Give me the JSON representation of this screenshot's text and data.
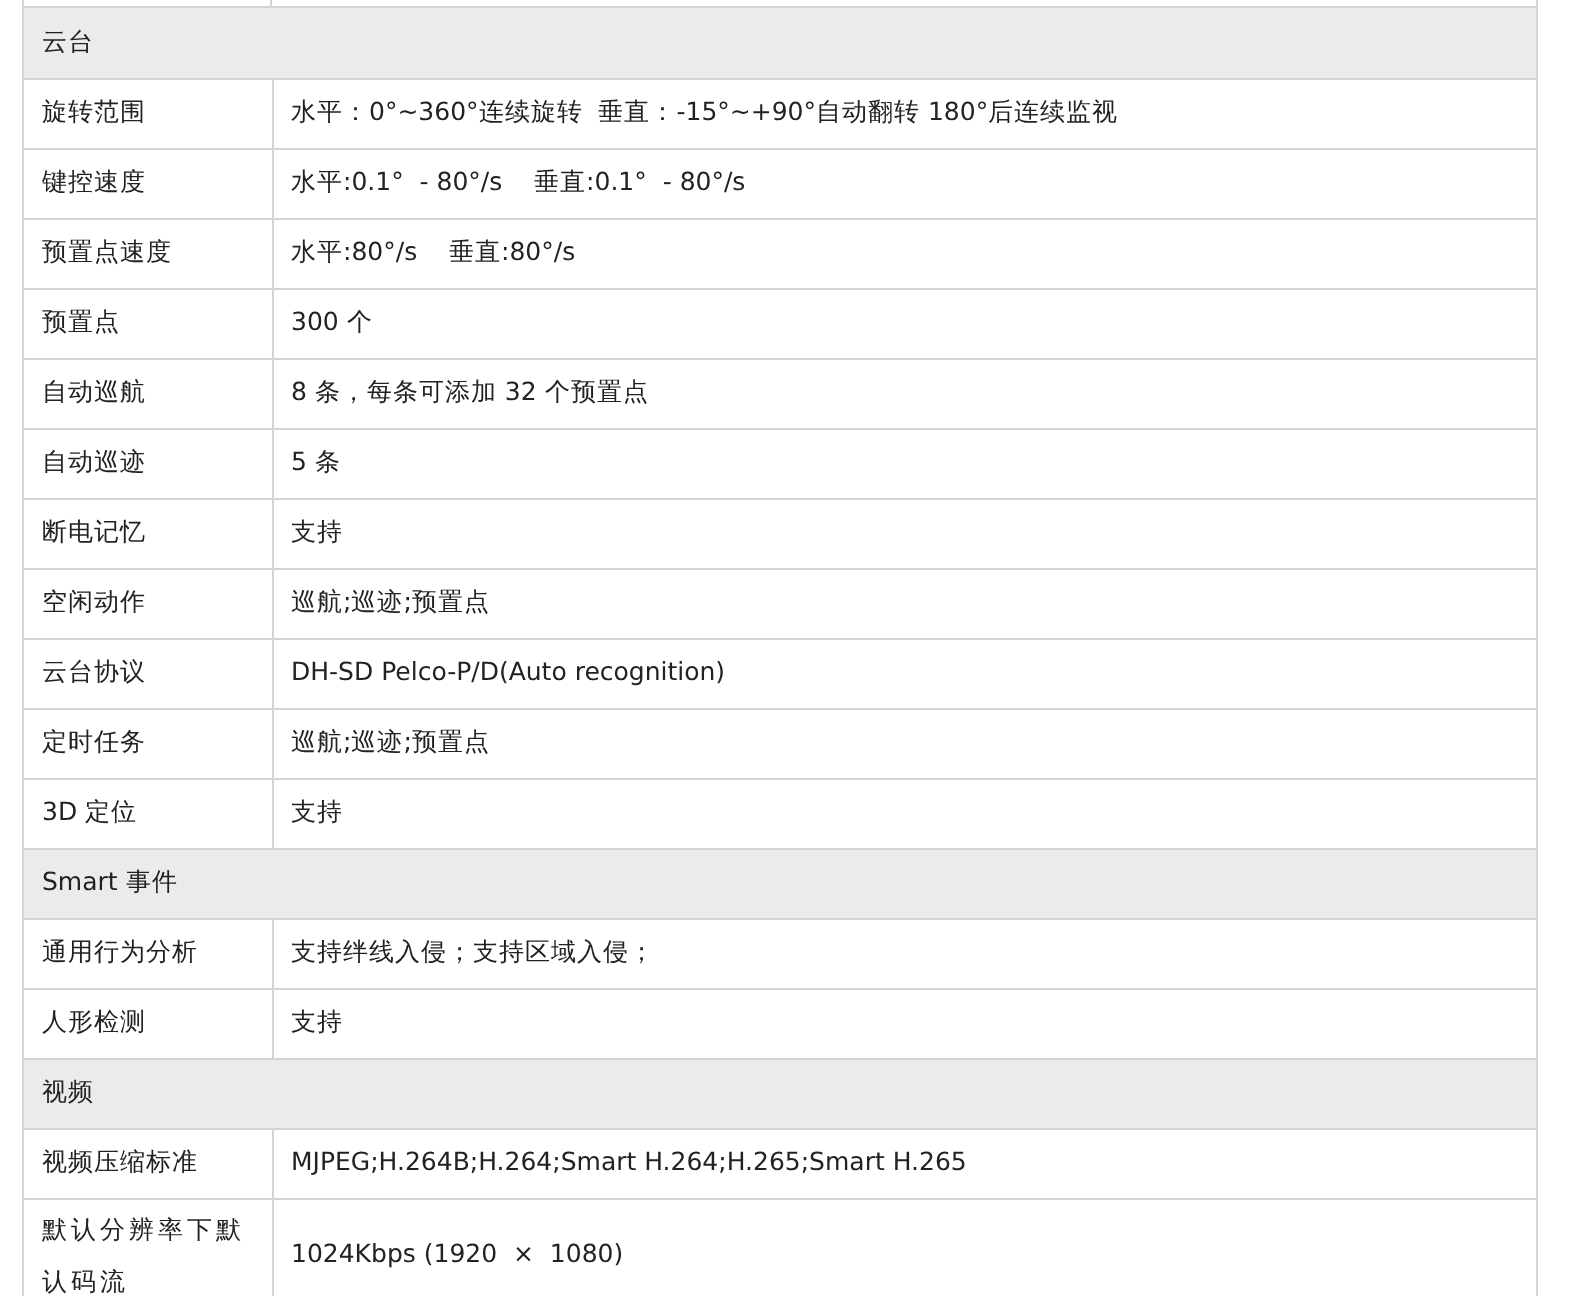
{
  "sections": [
    {
      "title": "云台",
      "rows": [
        {
          "label": "旋转范围",
          "value": "水平：0°~360°连续旋转  垂直：-15°~+90°自动翻转 180°后连续监视"
        },
        {
          "label": "键控速度",
          "value": "水平:0.1°  - 80°/s    垂直:0.1°  - 80°/s"
        },
        {
          "label": "预置点速度",
          "value": "水平:80°/s    垂直:80°/s"
        },
        {
          "label": "预置点",
          "value": "300 个"
        },
        {
          "label": "自动巡航",
          "value": "8 条，每条可添加 32 个预置点"
        },
        {
          "label": "自动巡迹",
          "value": "5 条"
        },
        {
          "label": "断电记忆",
          "value": "支持"
        },
        {
          "label": "空闲动作",
          "value": "巡航;巡迹;预置点"
        },
        {
          "label": "云台协议",
          "value": "DH-SD Pelco-P/D(Auto recognition)"
        },
        {
          "label": "定时任务",
          "value": "巡航;巡迹;预置点"
        },
        {
          "label": "3D 定位",
          "value": "支持"
        }
      ]
    },
    {
      "title": "Smart 事件",
      "rows": [
        {
          "label": "通用行为分析",
          "value": "支持绊线入侵；支持区域入侵；"
        },
        {
          "label": "人形检测",
          "value": "支持"
        }
      ]
    },
    {
      "title": "视频",
      "rows": [
        {
          "label": "视频压缩标准",
          "value": "MJPEG;H.264B;H.264;Smart H.264;H.265;Smart H.265"
        },
        {
          "label": "默认分辨率下默认码流",
          "value": "1024Kbps (1920  ×  1080)"
        }
      ]
    }
  ]
}
